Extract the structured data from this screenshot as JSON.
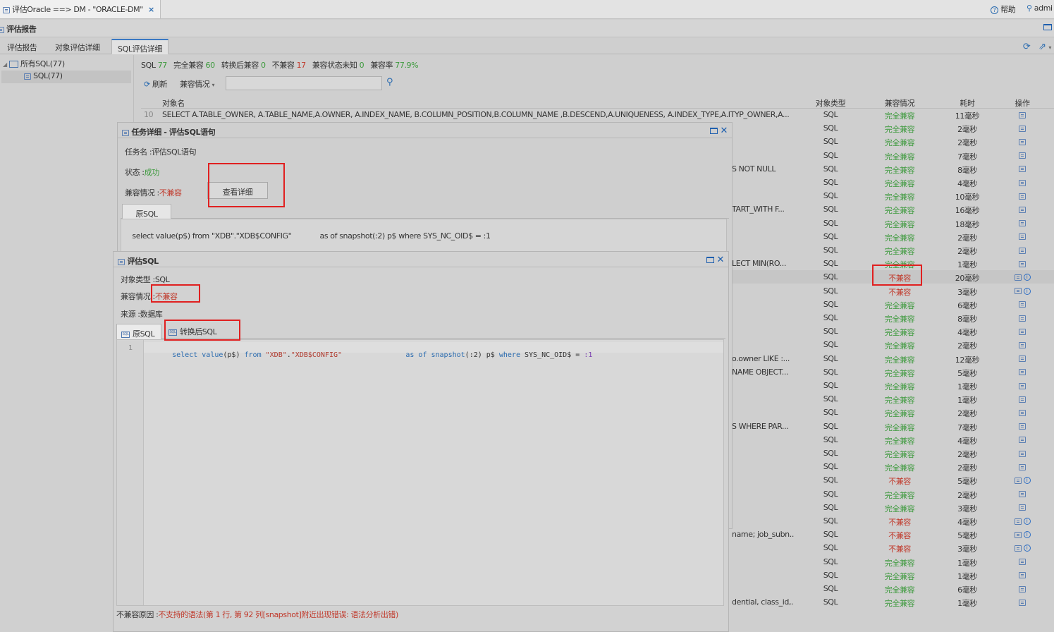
{
  "top": {
    "tab_title": "评估Oracle ==> DM - \"ORACLE-DM\"",
    "help": "帮助",
    "user": "admi"
  },
  "panel": {
    "title": "评估报告"
  },
  "tabs": [
    "评估报告",
    "对象评估详细",
    "SQL评估详细"
  ],
  "tree": {
    "root": "所有SQL(77)",
    "child": "SQL(77)"
  },
  "stats": {
    "sql_label": "SQL",
    "sql_count": "77",
    "full_label": "完全兼容",
    "full_count": "60",
    "conv_label": "转换后兼容",
    "conv_count": "0",
    "incomp_label": "不兼容",
    "incomp_count": "17",
    "unknown_label": "兼容状态未知",
    "unknown_count": "0",
    "rate_label": "兼容率",
    "rate_value": "77.9%"
  },
  "toolbar": {
    "refresh": "刷新",
    "compat_filter": "兼容情况",
    "search_value": ""
  },
  "table": {
    "headers": {
      "name": "对象名",
      "type": "对象类型",
      "compat": "兼容情况",
      "time": "耗时",
      "op": "操作"
    },
    "first_row_no": "10",
    "first_row_sql": "SELECT A.TABLE_OWNER, A.TABLE_NAME,A.OWNER, A.INDEX_NAME, B.COLUMN_POSITION,B.COLUMN_NAME ,B.DESCEND,A.UNIQUENESS, A.INDEX_TYPE,A.ITYP_OWNER,A...",
    "rows": [
      {
        "type": "SQL",
        "compat": "完全兼容",
        "time": "11毫秒",
        "ok": true,
        "sql": ""
      },
      {
        "type": "SQL",
        "compat": "完全兼容",
        "time": "2毫秒",
        "ok": true,
        "sql": ""
      },
      {
        "type": "SQL",
        "compat": "完全兼容",
        "time": "2毫秒",
        "ok": true,
        "sql": ""
      },
      {
        "type": "SQL",
        "compat": "完全兼容",
        "time": "7毫秒",
        "ok": true,
        "sql": ""
      },
      {
        "type": "SQL",
        "compat": "完全兼容",
        "time": "8毫秒",
        "ok": true,
        "sql": "S NOT NULL"
      },
      {
        "type": "SQL",
        "compat": "完全兼容",
        "time": "4毫秒",
        "ok": true,
        "sql": ""
      },
      {
        "type": "SQL",
        "compat": "完全兼容",
        "time": "10毫秒",
        "ok": true,
        "sql": ""
      },
      {
        "type": "SQL",
        "compat": "完全兼容",
        "time": "16毫秒",
        "ok": true,
        "sql": "TART_WITH F..."
      },
      {
        "type": "SQL",
        "compat": "完全兼容",
        "time": "18毫秒",
        "ok": true,
        "sql": ""
      },
      {
        "type": "SQL",
        "compat": "完全兼容",
        "time": "2毫秒",
        "ok": true,
        "sql": ""
      },
      {
        "type": "SQL",
        "compat": "完全兼容",
        "time": "2毫秒",
        "ok": true,
        "sql": ""
      },
      {
        "type": "SQL",
        "compat": "完全兼容",
        "time": "1毫秒",
        "ok": true,
        "sql": "LECT MIN(RO..."
      },
      {
        "type": "SQL",
        "compat": "不兼容",
        "time": "20毫秒",
        "ok": false,
        "sql": ""
      },
      {
        "type": "SQL",
        "compat": "不兼容",
        "time": "3毫秒",
        "ok": false,
        "sql": ""
      },
      {
        "type": "SQL",
        "compat": "完全兼容",
        "time": "6毫秒",
        "ok": true,
        "sql": ""
      },
      {
        "type": "SQL",
        "compat": "完全兼容",
        "time": "8毫秒",
        "ok": true,
        "sql": ""
      },
      {
        "type": "SQL",
        "compat": "完全兼容",
        "time": "4毫秒",
        "ok": true,
        "sql": ""
      },
      {
        "type": "SQL",
        "compat": "完全兼容",
        "time": "2毫秒",
        "ok": true,
        "sql": ""
      },
      {
        "type": "SQL",
        "compat": "完全兼容",
        "time": "12毫秒",
        "ok": true,
        "sql": "o.owner LIKE :..."
      },
      {
        "type": "SQL",
        "compat": "完全兼容",
        "time": "5毫秒",
        "ok": true,
        "sql": "NAME OBJECT..."
      },
      {
        "type": "SQL",
        "compat": "完全兼容",
        "time": "1毫秒",
        "ok": true,
        "sql": ""
      },
      {
        "type": "SQL",
        "compat": "完全兼容",
        "time": "1毫秒",
        "ok": true,
        "sql": ""
      },
      {
        "type": "SQL",
        "compat": "完全兼容",
        "time": "2毫秒",
        "ok": true,
        "sql": ""
      },
      {
        "type": "SQL",
        "compat": "完全兼容",
        "time": "7毫秒",
        "ok": true,
        "sql": "S WHERE PAR..."
      },
      {
        "type": "SQL",
        "compat": "完全兼容",
        "time": "4毫秒",
        "ok": true,
        "sql": ""
      },
      {
        "type": "SQL",
        "compat": "完全兼容",
        "time": "2毫秒",
        "ok": true,
        "sql": ""
      },
      {
        "type": "SQL",
        "compat": "完全兼容",
        "time": "2毫秒",
        "ok": true,
        "sql": ""
      },
      {
        "type": "SQL",
        "compat": "不兼容",
        "time": "5毫秒",
        "ok": false,
        "sql": ""
      },
      {
        "type": "SQL",
        "compat": "完全兼容",
        "time": "2毫秒",
        "ok": true,
        "sql": ""
      },
      {
        "type": "SQL",
        "compat": "完全兼容",
        "time": "3毫秒",
        "ok": true,
        "sql": ""
      },
      {
        "type": "SQL",
        "compat": "不兼容",
        "time": "4毫秒",
        "ok": false,
        "sql": ""
      },
      {
        "type": "SQL",
        "compat": "不兼容",
        "time": "5毫秒",
        "ok": false,
        "sql": "name; job_subn..."
      },
      {
        "type": "SQL",
        "compat": "不兼容",
        "time": "3毫秒",
        "ok": false,
        "sql": ""
      },
      {
        "type": "SQL",
        "compat": "完全兼容",
        "time": "1毫秒",
        "ok": true,
        "sql": ""
      },
      {
        "type": "SQL",
        "compat": "完全兼容",
        "time": "1毫秒",
        "ok": true,
        "sql": ""
      },
      {
        "type": "SQL",
        "compat": "完全兼容",
        "time": "6毫秒",
        "ok": true,
        "sql": ""
      },
      {
        "type": "SQL",
        "compat": "完全兼容",
        "time": "1毫秒",
        "ok": true,
        "sql": "dential, class_id,..."
      }
    ]
  },
  "task_win": {
    "title": "任务详细 - 评估SQL语句",
    "task_name_label": "任务名 :",
    "task_name": "评估SQL语句",
    "status_label": "状态 :",
    "status": "成功",
    "compat_label": "兼容情况 :",
    "compat": "不兼容",
    "detail_button": "查看详细",
    "tab": "原SQL",
    "sql_text": "select value(p$) from \"XDB\".\"XDB$CONFIG\"             as of snapshot(:2) p$ where SYS_NC_OID$ = :1"
  },
  "eval_win": {
    "title": "评估SQL",
    "type_label": "对象类型 :",
    "type": "SQL",
    "compat_label": "兼容情况 :",
    "compat": "不兼容",
    "source_label": "来源 :",
    "source": "数据库",
    "tab_orig": "原SQL",
    "tab_conv": "转换后SQL",
    "line_no": "1",
    "code": {
      "k1": "select",
      "f1": "value",
      "p1": "(p$)",
      "k2": "from",
      "s1": "\"XDB\"",
      "dot": ".",
      "s2": "\"XDB$CONFIG\"",
      "k3": "as",
      "k4": "of",
      "f2": "snapshot",
      "p2": "(:2) p$",
      "k5": "where",
      "p3": "SYS_NC_OID$ =",
      "p4": ":1"
    },
    "reason_label": "不兼容原因 :",
    "reason": "不支持的语法(第 1 行, 第 92 列[snapshot]附近出现错误: 语法分析出错)"
  }
}
